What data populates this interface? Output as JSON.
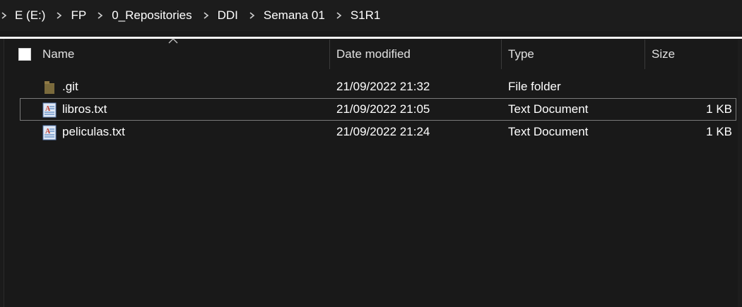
{
  "breadcrumb": {
    "items": [
      "E (E:)",
      "FP",
      "0_Repositories",
      "DDI",
      "Semana 01",
      "S1R1"
    ]
  },
  "columns": {
    "name": "Name",
    "date_modified": "Date modified",
    "type": "Type",
    "size": "Size"
  },
  "files": [
    {
      "name": ".git",
      "date": "21/09/2022 21:32",
      "type": "File folder",
      "size": "",
      "icon": "folder-icon"
    },
    {
      "name": "libros.txt",
      "date": "21/09/2022 21:05",
      "type": "Text Document",
      "size": "1 KB",
      "icon": "text-document-icon",
      "selected": true
    },
    {
      "name": "peliculas.txt",
      "date": "21/09/2022 21:24",
      "type": "Text Document",
      "size": "1 KB",
      "icon": "text-document-icon"
    }
  ],
  "colors": {
    "background": "#191919",
    "folder": "#8f7a45",
    "text": "#ffffff",
    "selection_border": "#7a7a7a"
  }
}
